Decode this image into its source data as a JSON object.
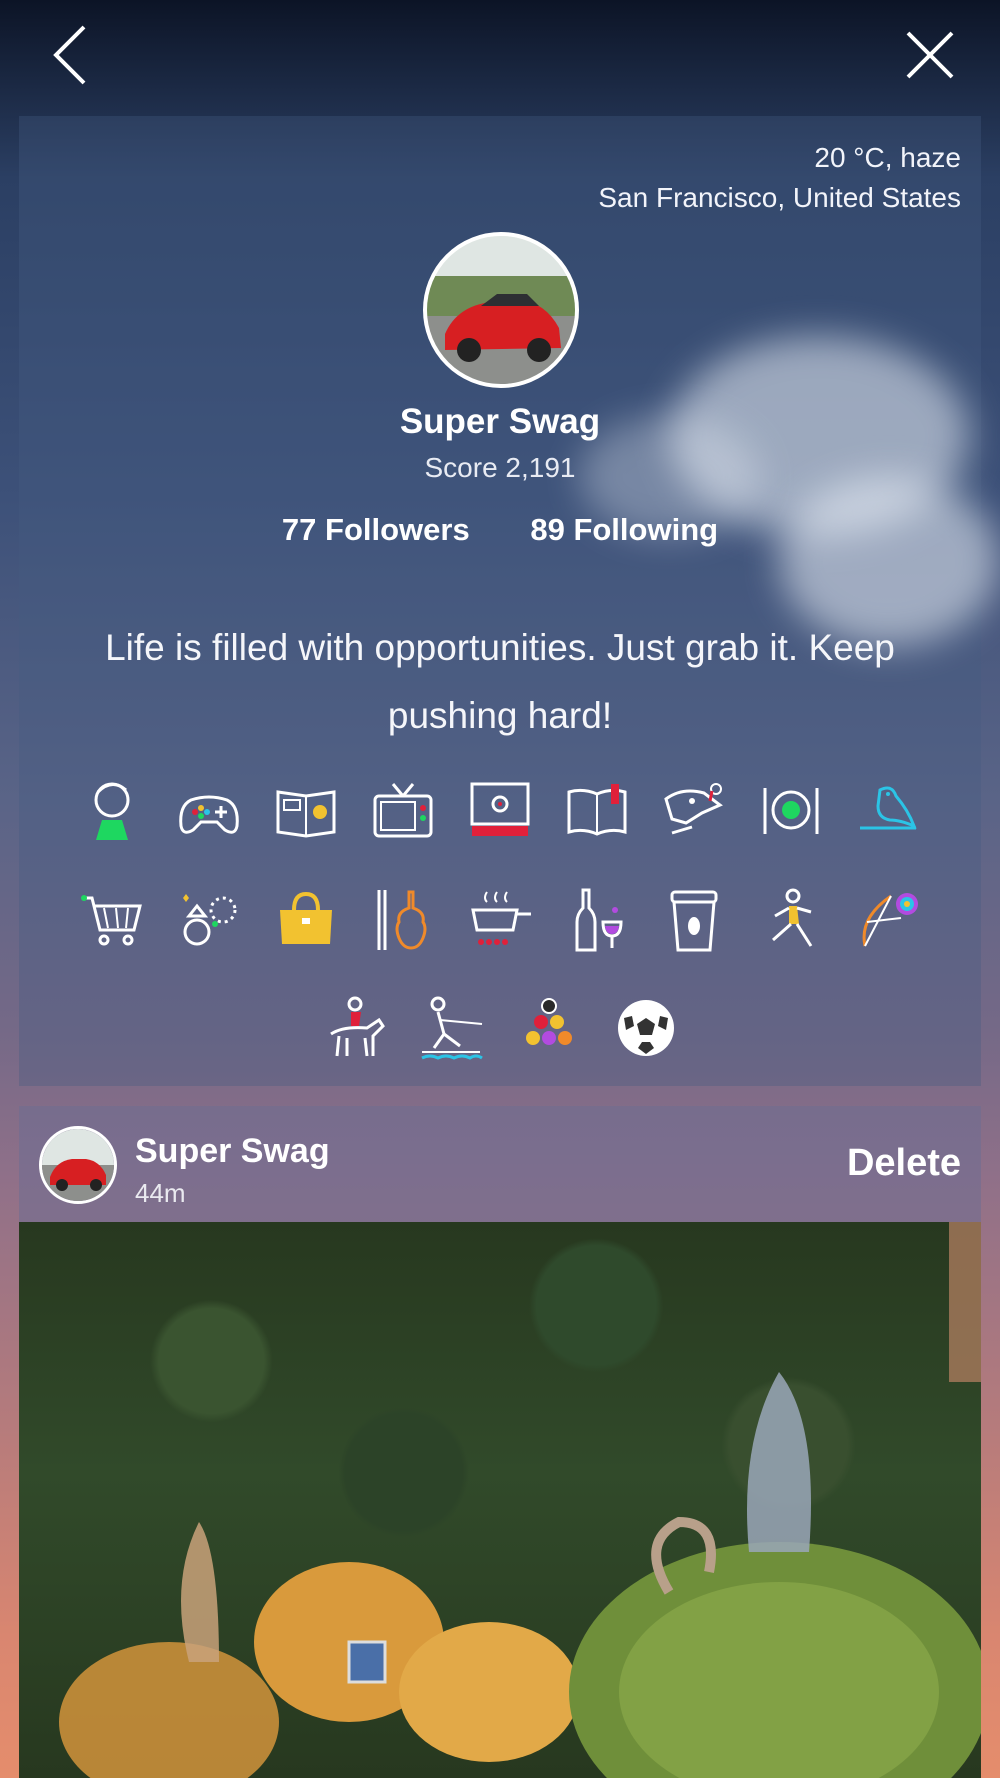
{
  "nav": {
    "back_icon": "chevron-left-icon",
    "close_icon": "close-icon"
  },
  "profile": {
    "weather": "20 °C, haze",
    "location": "San Francisco, United States",
    "name": "Super Swag",
    "score": "Score 2,191",
    "followers": "77 Followers",
    "following": "89 Following",
    "bio": "Life is filled with opportunities. Just grab it. Keep pushing hard!",
    "interests": [
      "kid-icon",
      "gamepad-icon",
      "comic-icon",
      "tv-icon",
      "film-icon",
      "book-icon",
      "dinosaur-icon",
      "dining-icon",
      "bird-icon",
      "shopping-cart-icon",
      "ring-icon",
      "handbag-icon",
      "violin-icon",
      "cooking-pot-icon",
      "wine-icon",
      "coffee-cup-icon",
      "running-icon",
      "archery-icon",
      "horse-riding-icon",
      "water-ski-icon",
      "billiard-icon",
      "soccer-ball-icon"
    ]
  },
  "post": {
    "author": "Super Swag",
    "time": "44m",
    "delete_label": "Delete"
  },
  "colors": {
    "accent_green": "#1ed760",
    "accent_red": "#e0203a",
    "accent_yellow": "#f2c230",
    "accent_cyan": "#2bc4e6",
    "accent_purple": "#b24be0"
  }
}
